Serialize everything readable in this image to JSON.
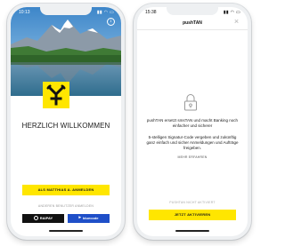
{
  "left_screen": {
    "status_time": "10:13",
    "status_icons": "▮▮ ◠ ▭",
    "info_icon": "info-icon",
    "welcome_title": "HERZLICH WILLKOMMEN",
    "login_button": "ALS MATTHIAS A. ANMELDEN",
    "other_user_link": "ANDEREN BENUTZER ANMELDEN",
    "pay_buttons": [
      {
        "label": "RAIPAY",
        "icon": "circle-icon"
      },
      {
        "label": "bluecode",
        "icon": "bluecode-logo-icon"
      }
    ],
    "colors": {
      "accent": "#ffe600",
      "bluecode": "#1f4fc8",
      "raipay": "#111111"
    }
  },
  "right_screen": {
    "status_time": "15:38",
    "status_icons": "▮▮ ◠ ▭",
    "title": "pushTAN",
    "close_icon": "×",
    "paragraph_1": "pushTAN ersetzt smsTAN und macht Banking noch einfacher und sicherer",
    "paragraph_2": "5-stelligen Signatur-Code vergeben und zukünftig ganz einfach und sicher Anmeldungen und Aufträge freigeben.",
    "more_link": "MEHR ERFAHREN",
    "status_text": "PUSHTAN NICHT AKTIVIERT",
    "activate_button": "JETZT AKTIVIEREN",
    "colors": {
      "accent": "#ffe600"
    }
  }
}
